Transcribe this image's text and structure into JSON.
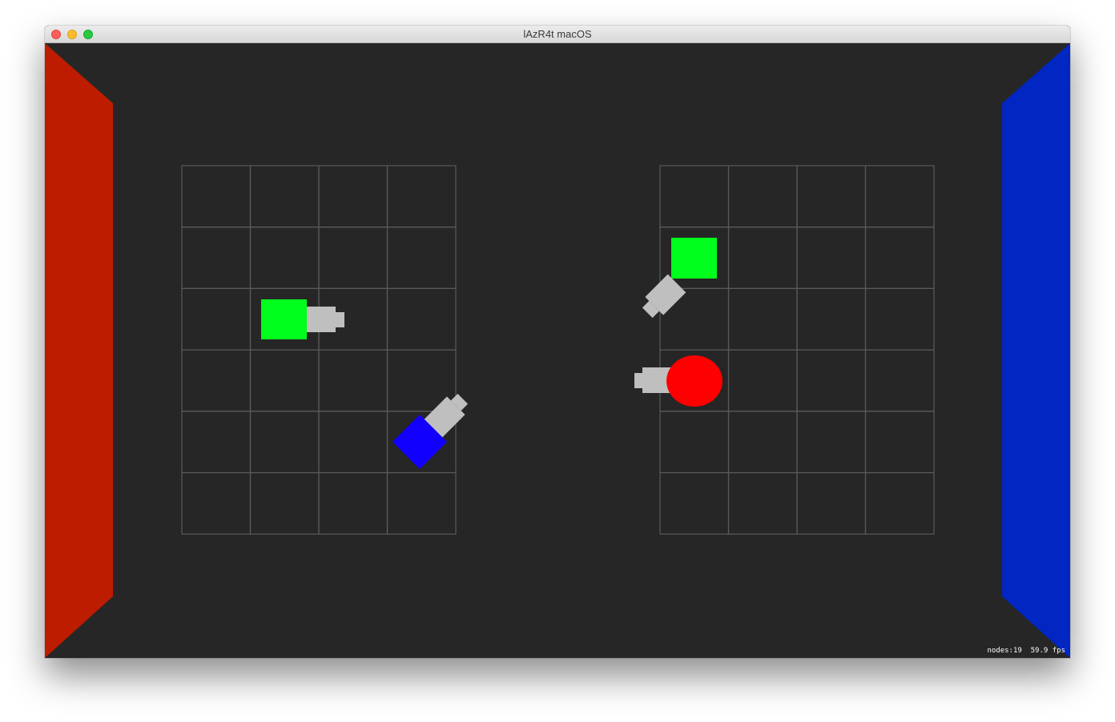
{
  "window": {
    "title": "lAzR4t macOS",
    "controls": [
      "close",
      "minimize",
      "zoom"
    ]
  },
  "game": {
    "left_wall_color": "#bd1c00",
    "right_wall_color": "#0226c1",
    "background_color": "#262626",
    "grid_line_color": "#5a5a5a",
    "grid_columns": 4,
    "grid_rows": 6,
    "boards": [
      "left-board",
      "right-board"
    ],
    "units": [
      {
        "id": "left-green-tank",
        "board": "left",
        "shape": "square",
        "color": "#00ff1c",
        "direction": "right"
      },
      {
        "id": "left-blue-tank",
        "board": "left",
        "shape": "square",
        "color": "#1200ff",
        "direction": "up-right"
      },
      {
        "id": "right-green-tank",
        "board": "right",
        "shape": "square",
        "color": "#00ff1c",
        "direction": "down-left"
      },
      {
        "id": "right-red-tank",
        "board": "right",
        "shape": "circle",
        "color": "#ff0000",
        "direction": "left"
      }
    ],
    "cannon_color": "#bfbfbf"
  },
  "stats": {
    "nodes_label": "nodes:19",
    "fps_label": "59.9 fps"
  }
}
